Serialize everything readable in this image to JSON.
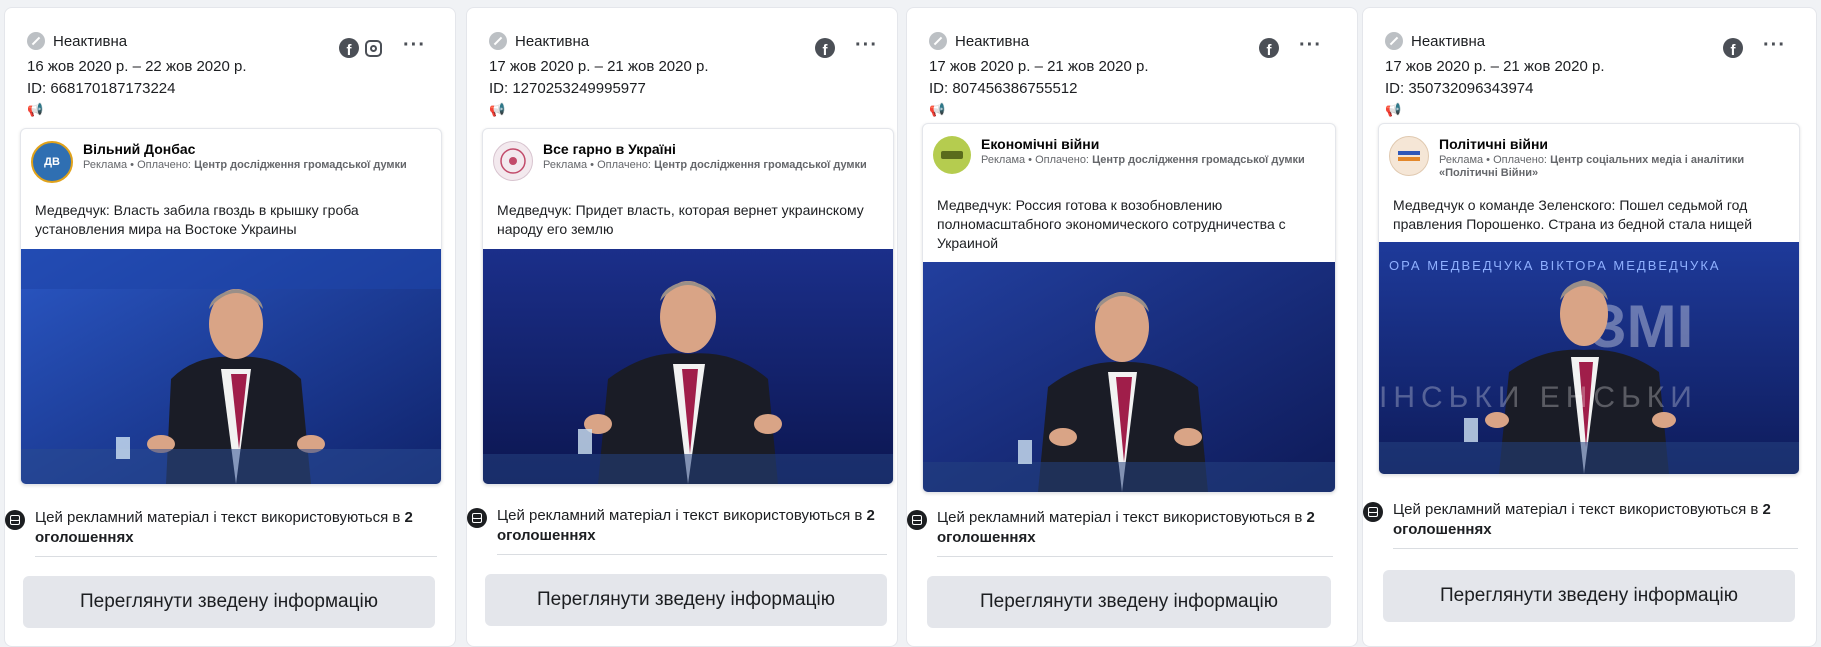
{
  "cards": [
    {
      "status": "Неактивна",
      "dates": "16 жов 2020 р. – 22 жов 2020 р.",
      "id": "ID: 668170187173224",
      "platforms": [
        "facebook-icon",
        "instagram-icon"
      ],
      "page_name": "Вільний Донбас",
      "sponsored_label": "Реклама • Оплачено:",
      "sponsor": "Центр дослідження громадської думки",
      "ad_text": "Медведчук: Власть забила гвоздь в крышку гроба установления мира на Востоке Украины",
      "usage_text": "Цей рекламний матеріал і текст використовуються в",
      "usage_count": "2 оголошеннях",
      "button": "Переглянути зведену інформацію",
      "avatar_text": "ДВ",
      "avatar_color": "#2f6fb2"
    },
    {
      "status": "Неактивна",
      "dates": "17 жов 2020 р. – 21 жов 2020 р.",
      "id": "ID: 1270253249995977",
      "platforms": [
        "facebook-icon"
      ],
      "page_name": "Все гарно в Україні",
      "sponsored_label": "Реклама • Оплачено:",
      "sponsor": "Центр дослідження громадської думки",
      "ad_text": "Медведчук: Придет власть, которая вернет украинскому народу его землю",
      "usage_text": "Цей рекламний матеріал і текст використовуються в",
      "usage_count": "2 оголошеннях",
      "button": "Переглянути зведену інформацію",
      "avatar_text": "",
      "avatar_color": "#f3e9ee"
    },
    {
      "status": "Неактивна",
      "dates": "17 жов 2020 р. – 21 жов 2020 р.",
      "id": "ID: 807456386755512",
      "platforms": [
        "facebook-icon"
      ],
      "page_name": "Економічні війни",
      "sponsored_label": "Реклама • Оплачено:",
      "sponsor": "Центр дослідження громадської думки",
      "ad_text": "Медведчук: Россия готова к возобновлению полномасштабного экономического сотрудничества с Украиной",
      "usage_text": "Цей рекламний матеріал і текст використовуються в",
      "usage_count": "2 оголошеннях",
      "button": "Переглянути зведену інформацію",
      "avatar_text": "",
      "avatar_color": "#b5cc4f"
    },
    {
      "status": "Неактивна",
      "dates": "17 жов 2020 р. – 21 жов 2020 р.",
      "id": "ID: 350732096343974",
      "platforms": [
        "facebook-icon"
      ],
      "page_name": "Політичні війни",
      "sponsored_label": "Реклама • Оплачено:",
      "sponsor": "Центр соціальних медіа і аналітики «Політичні Війни»",
      "ad_text": "Медведчук о команде Зеленского: Пошел седьмой год правления Порошенко. Страна из бедной стала нищей",
      "usage_text": "Цей рекламний матеріал і текст використовуються в",
      "usage_count": "2 оголошеннях",
      "button": "Переглянути зведену інформацію",
      "avatar_text": "",
      "avatar_color": "#f5e6d6"
    }
  ],
  "image_overlay_text": {
    "card4_banner": "ОРА МЕДВЕДЧУКА   ВІКТОРА МЕДВЕДЧУКА",
    "card4_bottom": "ІНСЬКИ        ЕНСЬКИ"
  },
  "colors": {
    "studio_blue": "#1d3f9a",
    "studio_dark": "#0f1d55",
    "button_bg": "#e4e6eb",
    "status_gray": "#bcc0c4"
  }
}
